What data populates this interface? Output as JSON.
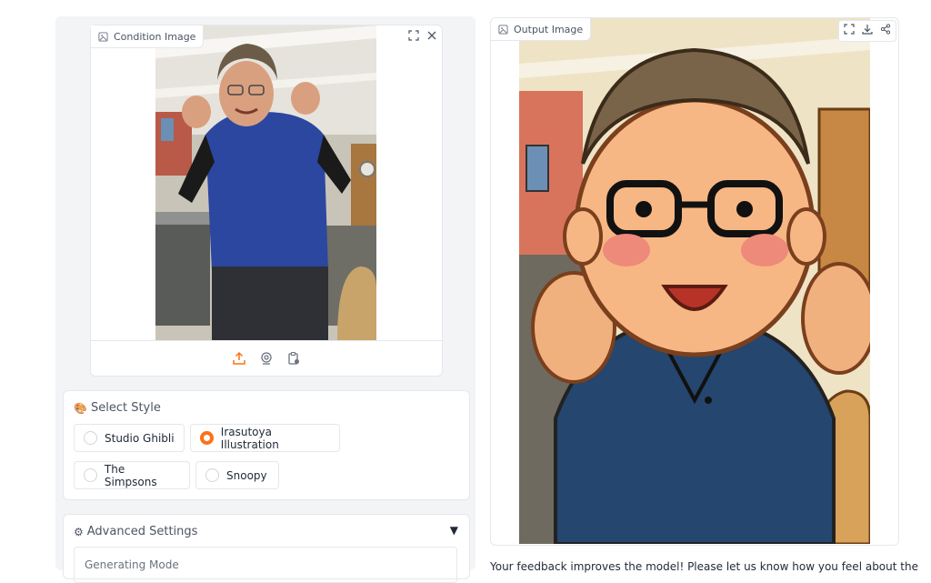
{
  "condition_panel": {
    "label": "Condition Image",
    "icons": [
      "upload-icon",
      "webcam-icon",
      "clipboard-icon",
      "fullscreen-icon",
      "close-icon"
    ]
  },
  "style_panel": {
    "title": "Select Style",
    "title_icon": "palette-icon",
    "options": [
      {
        "label": "Studio Ghibli",
        "selected": false
      },
      {
        "label": "Irasutoya Illustration",
        "selected": true
      },
      {
        "label": "The Simpsons",
        "selected": false
      },
      {
        "label": "Snoopy",
        "selected": false
      }
    ],
    "accent": "#f97316"
  },
  "advanced_panel": {
    "title": "Advanced Settings",
    "title_icon": "gear-icon",
    "toggle_icon": "triangle-down-icon",
    "field_label": "Generating Mode"
  },
  "output_panel": {
    "label": "Output Image",
    "icons": [
      "fullscreen-icon",
      "download-icon",
      "share-icon"
    ]
  },
  "feedback_text": "Your feedback improves the model! Please let us know how you feel about the"
}
